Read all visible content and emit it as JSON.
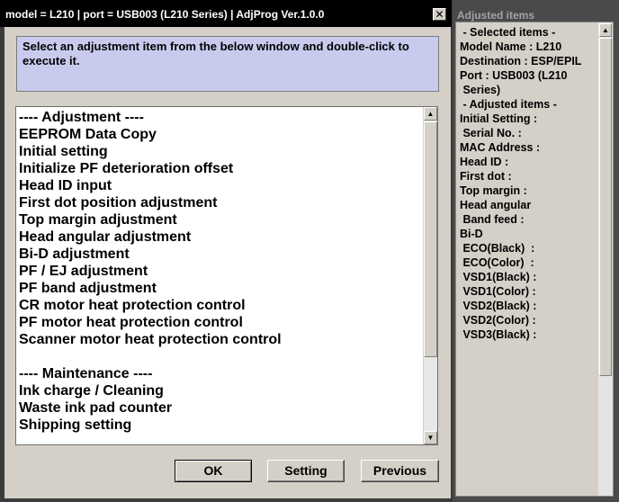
{
  "window": {
    "title": "model = L210 | port = USB003 (L210 Series) | AdjProg Ver.1.0.0",
    "close_glyph": "✕"
  },
  "instructions": "Select an adjustment item from the below window and double-click to execute it.",
  "list": {
    "items": [
      "---- Adjustment ----",
      "EEPROM Data Copy",
      "Initial setting",
      "Initialize PF deterioration offset",
      "Head ID input",
      "First dot position adjustment",
      "Top margin adjustment",
      "Head angular adjustment",
      "Bi-D adjustment",
      "PF / EJ adjustment",
      "PF band adjustment",
      "CR motor heat protection control",
      "PF motor heat protection control",
      "Scanner motor heat protection control",
      "",
      "---- Maintenance ----",
      "Ink charge / Cleaning",
      "Waste ink pad counter",
      "Shipping setting"
    ]
  },
  "buttons": {
    "ok": "OK",
    "setting": "Setting",
    "previous": "Previous"
  },
  "scroll": {
    "up_glyph": "▲",
    "down_glyph": "▼"
  },
  "side": {
    "title": "Adjusted items",
    "lines": [
      " - Selected items -",
      "",
      "Model Name : L210",
      "Destination : ESP/EPIL",
      "Port : USB003 (L210",
      " Series)",
      "",
      " - Adjusted items -",
      "",
      "Initial Setting :",
      "",
      " Serial No. :",
      "",
      "MAC Address :",
      "",
      "Head ID :",
      "",
      "First dot :",
      "",
      "Top margin :",
      "",
      "Head angular",
      " Band feed :",
      "",
      "Bi-D",
      " ECO(Black)  :",
      " ECO(Color)  :",
      " VSD1(Black) :",
      " VSD1(Color) :",
      " VSD2(Black) :",
      " VSD2(Color) :",
      " VSD3(Black) :"
    ]
  }
}
